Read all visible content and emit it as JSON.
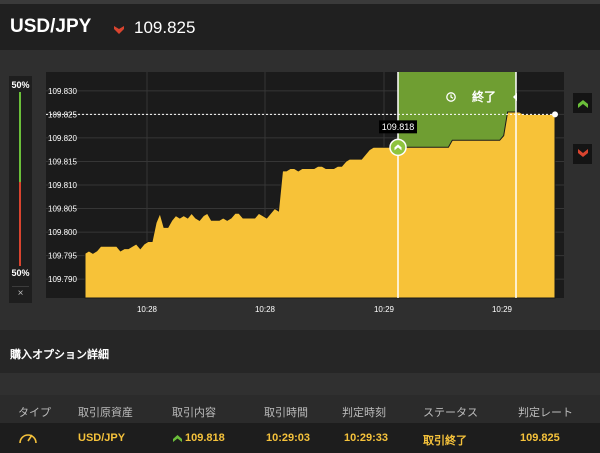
{
  "header": {
    "pair": "USD/JPY",
    "price": "109.825",
    "price_direction": "down",
    "direction_color": "#d9442f"
  },
  "meter": {
    "top_label": "50%",
    "bottom_label": "50%",
    "close_glyph": "×",
    "up_share": 0.5
  },
  "chart_data": {
    "type": "area",
    "y_ticks": [
      "109.830",
      "109.825",
      "109.820",
      "109.815",
      "109.810",
      "109.805",
      "109.800",
      "109.795",
      "109.790"
    ],
    "x_ticks": [
      "10:28",
      "10:28",
      "10:29",
      "10:29"
    ],
    "ylim": [
      109.786,
      109.834
    ],
    "current_rate": "109.825",
    "entry_marker": {
      "label": "109.818",
      "value": 109.818
    },
    "expiry_label": "終了",
    "fill_color": "#f7c238",
    "window_color": "#6f9e32",
    "series_values": [
      109.7955,
      109.796,
      109.7955,
      109.796,
      109.797,
      109.797,
      109.797,
      109.797,
      109.797,
      109.796,
      109.7965,
      109.7965,
      109.797,
      109.7975,
      109.7965,
      109.7975,
      109.798,
      109.798,
      109.802,
      109.804,
      109.801,
      109.801,
      109.8025,
      109.8035,
      109.803,
      109.8035,
      109.803,
      109.804,
      109.803,
      109.8025,
      109.8035,
      109.804,
      109.8025,
      109.8025,
      109.8025,
      109.803,
      109.8025,
      109.803,
      109.804,
      109.804,
      109.803,
      109.803,
      109.803,
      109.803,
      109.804,
      109.8035,
      109.803,
      109.804,
      109.805,
      109.8045,
      109.813,
      109.813,
      109.8135,
      109.8135,
      109.813,
      109.8135,
      109.8135,
      109.8135,
      109.8135,
      109.814,
      109.814,
      109.8135,
      109.8135,
      109.8135,
      109.814,
      109.814,
      109.815,
      109.8155,
      109.8155,
      109.8155,
      109.8155,
      109.8165,
      109.8175,
      109.818,
      109.818,
      109.818,
      109.818,
      109.818,
      109.818,
      109.818,
      109.818,
      109.818,
      109.818,
      109.818,
      109.818,
      109.818,
      109.818,
      109.818,
      109.818,
      109.818,
      109.818,
      109.818,
      109.818,
      109.8195,
      109.8195,
      109.8195,
      109.8195,
      109.8195,
      109.8195,
      109.8195,
      109.8195,
      109.8195,
      109.8195,
      109.8195,
      109.8195,
      109.8195,
      109.8205,
      109.8255,
      109.8255,
      109.8255,
      109.8255,
      109.825,
      109.825,
      109.825,
      109.825,
      109.825,
      109.825,
      109.825,
      109.825,
      109.825
    ]
  },
  "section": {
    "title": "購入オプション詳細"
  },
  "table": {
    "headers": [
      "タイプ",
      "取引原資産",
      "取引内容",
      "取引時間",
      "判定時刻",
      "ステータス",
      "判定レート"
    ],
    "row": {
      "type_icon": "gauge-icon",
      "asset": "USD/JPY",
      "content": "109.818",
      "content_direction": "up",
      "trade_time": "10:29:03",
      "judge_time": "10:29:33",
      "status": "取引終了",
      "judge_rate": "109.825"
    }
  },
  "colors": {
    "up": "#6bbf3a",
    "down": "#d9442f",
    "accent_yellow": "#f5c23b"
  }
}
